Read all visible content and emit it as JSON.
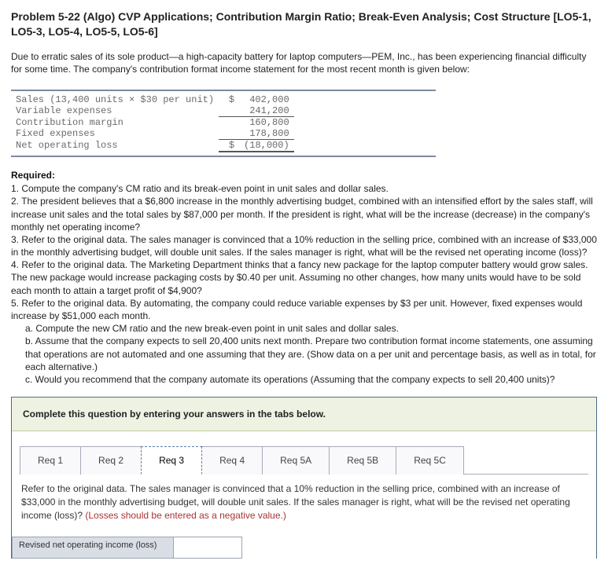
{
  "problem": {
    "title": "Problem 5-22 (Algo) CVP Applications; Contribution Margin Ratio; Break-Even Analysis; Cost Structure [LO5-1, LO5-3, LO5-4, LO5-5, LO5-6]",
    "intro": "Due to erratic sales of its sole product—a high-capacity battery for laptop computers—PEM, Inc., has been experiencing financial difficulty for some time. The company's contribution format income statement for the most recent month is given below:"
  },
  "income": {
    "rows": [
      {
        "label": "Sales (13,400 units × $30 per unit)",
        "sign": "$",
        "value": "402,000"
      },
      {
        "label": "Variable expenses",
        "sign": "",
        "value": "241,200"
      },
      {
        "label": "Contribution margin",
        "sign": "",
        "value": "160,800"
      },
      {
        "label": "Fixed expenses",
        "sign": "",
        "value": "178,800"
      },
      {
        "label": "Net operating loss",
        "sign": "$",
        "value": "(18,000)"
      }
    ]
  },
  "required": {
    "heading": "Required:",
    "items": {
      "r1": "1. Compute the company's CM ratio and its break-even point in unit sales and dollar sales.",
      "r2": "2. The president believes that a $6,800 increase in the monthly advertising budget, combined with an intensified effort by the sales staff, will increase unit sales and the total sales by $87,000 per month. If the president is right, what will be the increase (decrease) in the company's monthly net operating income?",
      "r3": "3. Refer to the original data. The sales manager is convinced that a 10% reduction in the selling price, combined with an increase of $33,000 in the monthly advertising budget, will double unit sales. If the sales manager is right, what will be the revised net operating income (loss)?",
      "r4": "4. Refer to the original data. The Marketing Department thinks that a fancy new package for the laptop computer battery would grow sales. The new package would increase packaging costs by $0.40 per unit. Assuming no other changes, how many units would have to be sold each month to attain a target profit of $4,900?",
      "r5": "5. Refer to the original data. By automating, the company could reduce variable expenses by $3 per unit. However, fixed expenses would increase by $51,000 each month.",
      "r5a": "a. Compute the new CM ratio and the new break-even point in unit sales and dollar sales.",
      "r5b": "b. Assume that the company expects to sell 20,400 units next month. Prepare two contribution format income statements, one assuming that operations are not automated and one assuming that they are. (Show data on a per unit and percentage basis, as well as in total, for each alternative.)",
      "r5c": "c. Would you recommend that the company automate its operations (Assuming that the company expects to sell 20,400 units)?"
    }
  },
  "answerArea": {
    "instruction": "Complete this question by entering your answers in the tabs below.",
    "tabs": {
      "t1": "Req 1",
      "t2": "Req 2",
      "t3": "Req 3",
      "t4": "Req 4",
      "t5": "Req 5A",
      "t6": "Req 5B",
      "t7": "Req 5C"
    },
    "activeTab": "t3",
    "tabContent": {
      "prompt_main": "Refer to the original data. The sales manager is convinced that a 10% reduction in the selling price, combined with an increase of $33,000 in the monthly advertising budget, will double unit sales. If the sales manager is right, what will be the revised net operating income (loss)? ",
      "prompt_red": "(Losses should be entered as a negative value.)",
      "result_label": "Revised net operating income (loss)",
      "result_value": ""
    }
  },
  "chart_data": {
    "type": "table",
    "title": "Contribution format income statement (most recent month)",
    "rows": [
      {
        "label": "Sales (13,400 units × $30 per unit)",
        "value": 402000
      },
      {
        "label": "Variable expenses",
        "value": 241200
      },
      {
        "label": "Contribution margin",
        "value": 160800
      },
      {
        "label": "Fixed expenses",
        "value": 178800
      },
      {
        "label": "Net operating loss",
        "value": -18000
      }
    ]
  }
}
